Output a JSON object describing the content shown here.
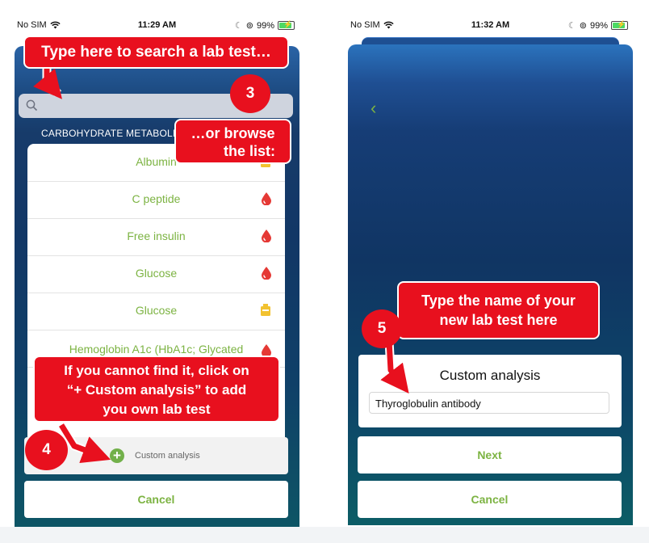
{
  "phone1": {
    "status": {
      "carrier": "No SIM",
      "time": "11:29 AM",
      "battery": "99%"
    },
    "section_header": "CARBOHYDRATE METABOLISM",
    "items": [
      {
        "label": "Albumin",
        "icon": "urine-icon"
      },
      {
        "label": "C peptide",
        "icon": "blood-drop-icon"
      },
      {
        "label": "Free insulin",
        "icon": "blood-drop-icon"
      },
      {
        "label": "Glucose",
        "icon": "blood-drop-icon"
      },
      {
        "label": "Glucose",
        "icon": "urine-icon"
      },
      {
        "label": "Hemoglobin A1c (HbA1c; Glycated",
        "icon": "blood-drop-icon"
      }
    ],
    "custom_label": "Custom analysis",
    "cancel_label": "Cancel"
  },
  "phone2": {
    "status": {
      "carrier": "No SIM",
      "time": "11:32 AM",
      "battery": "99%"
    },
    "card_title": "Custom analysis",
    "input_value": "Thyroglobulin antibody",
    "next_label": "Next",
    "cancel_label": "Cancel"
  },
  "callouts": {
    "search": "Type here to search a lab test…",
    "browse_line1": "…or browse",
    "browse_line2": "the list:",
    "custom_line1": "If you cannot find it, click on",
    "custom_line2": "“+ Custom analysis” to add",
    "custom_line3": "you own lab test",
    "name_line1": "Type the name of your",
    "name_line2": "new lab test here"
  },
  "badges": {
    "b3": "3",
    "b4": "4",
    "b5": "5"
  },
  "colors": {
    "accent": "#7cb342",
    "callout": "#e8101e",
    "drop": "#e53935",
    "urine": "#f2c230"
  }
}
